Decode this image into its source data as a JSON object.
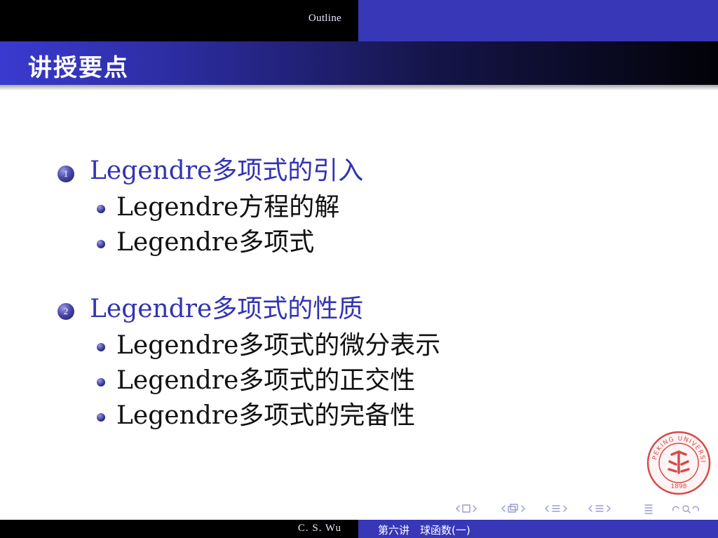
{
  "header": {
    "section": "Outline"
  },
  "frame": {
    "title": "讲授要点"
  },
  "outline": [
    {
      "number": "1",
      "label": "Legendre多项式的引入",
      "subitems": [
        "Legendre方程的解",
        "Legendre多项式"
      ]
    },
    {
      "number": "2",
      "label": "Legendre多项式的性质",
      "subitems": [
        "Legendre多项式的微分表示",
        "Legendre多项式的正交性",
        "Legendre多项式的完备性"
      ]
    }
  ],
  "footer": {
    "author": "C. S. Wu",
    "lecture": "第六讲　球函数(一)"
  },
  "seal": {
    "text": "PEKING UNIVERSITY",
    "year": "1898"
  },
  "colors": {
    "accent": "#3737b8",
    "bar": "#000000",
    "seal": "#d84a4a"
  },
  "nav_icons": [
    "frame-prev-icon",
    "frame-next-icon",
    "subsection-prev-icon",
    "subsection-next-icon",
    "section-prev-icon",
    "section-next-icon",
    "outline-icon",
    "search-icon"
  ]
}
